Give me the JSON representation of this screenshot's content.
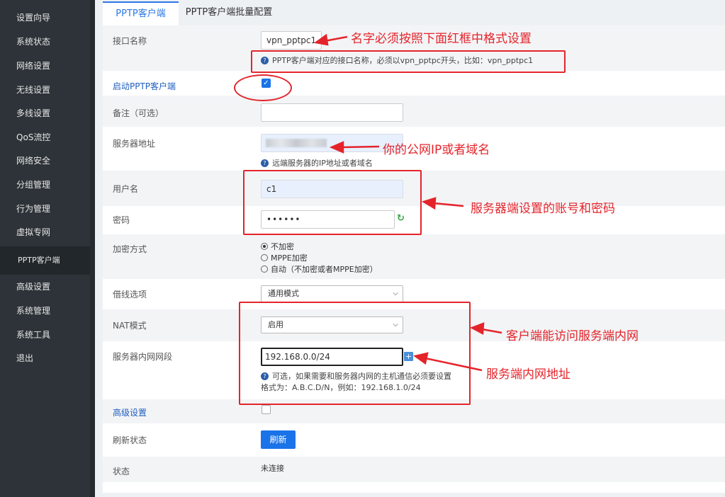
{
  "sidebar": {
    "items": [
      {
        "label": "设置向导"
      },
      {
        "label": "系统状态"
      },
      {
        "label": "网络设置"
      },
      {
        "label": "无线设置"
      },
      {
        "label": "多线设置"
      },
      {
        "label": "QoS流控"
      },
      {
        "label": "网络安全"
      },
      {
        "label": "分组管理"
      },
      {
        "label": "行为管理"
      },
      {
        "label": "虚拟专网"
      },
      {
        "label": "PPTP客户端",
        "active": true
      },
      {
        "label": "高级设置"
      },
      {
        "label": "系统管理"
      },
      {
        "label": "系统工具"
      },
      {
        "label": "退出"
      }
    ]
  },
  "tabs": [
    {
      "label": "PPTP客户端",
      "active": true
    },
    {
      "label": "PPTP客户端批量配置"
    }
  ],
  "form": {
    "interface_name": {
      "label": "接口名称",
      "value": "vpn_pptpc1",
      "help": "PPTP客户端对应的接口名称，必须以vpn_pptpc开头，比如：vpn_pptpc1"
    },
    "enable": {
      "label": "启动PPTP客户端",
      "checked": true
    },
    "remark": {
      "label": "备注（可选）",
      "value": ""
    },
    "server_address": {
      "label": "服务器地址",
      "help": "远端服务器的IP地址或者域名"
    },
    "username": {
      "label": "用户名",
      "value": "c1"
    },
    "password": {
      "label": "密码",
      "value": "••••••"
    },
    "encryption": {
      "label": "加密方式",
      "options": [
        {
          "label": "不加密",
          "selected": true
        },
        {
          "label": "MPPE加密",
          "selected": false
        },
        {
          "label": "自动（不加密或者MPPE加密）",
          "selected": false
        }
      ]
    },
    "line_option": {
      "label": "借线选项",
      "value": "通用模式"
    },
    "nat_mode": {
      "label": "NAT模式",
      "value": "启用"
    },
    "server_subnet": {
      "label": "服务器内网网段",
      "value": "192.168.0.0/24",
      "help_line1": "可选，如果需要和服务器内网的主机通信必须要设置",
      "help_line2": "格式为：A.B.C.D/N，例如：192.168.1.0/24"
    },
    "advanced": {
      "label": "高级设置",
      "checked": false
    },
    "refresh_status": {
      "label": "刷新状态",
      "button": "刷新"
    },
    "status": {
      "label": "状态",
      "value": "未连接"
    }
  },
  "annotations": {
    "name_note": "名字必须按照下面红框中格式设置",
    "server_note": "你的公网IP或者域名",
    "account_note": "服务器端设置的账号和密码",
    "nat_note": "客户端能访问服务端内网",
    "subnet_note": "服务端内网地址"
  },
  "colors": {
    "accent": "#1a73e8",
    "annotation": "#e4242b",
    "sidebar": "#2d3338"
  }
}
